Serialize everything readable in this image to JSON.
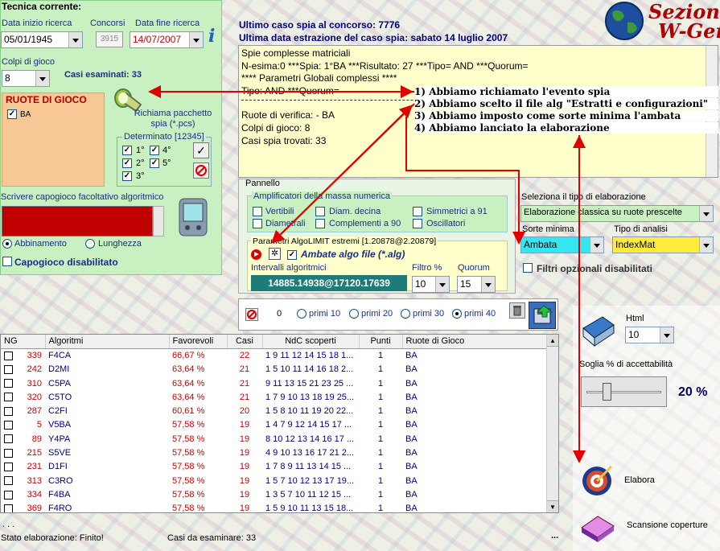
{
  "tecnica": {
    "title": "Tecnica corrente:",
    "data_inizio_label": "Data inizio ricerca",
    "data_inizio": "05/01/1945",
    "concorsi_label": "Concorsi",
    "concorsi": "3915",
    "data_fine_label": "Data fine ricerca",
    "data_fine": "14/07/2007",
    "colpi_label": "Colpi di gioco",
    "colpi": "8",
    "casi_esaminati": "Casi esaminati: 33"
  },
  "ruote": {
    "title": "RUOTE DI GIOCO",
    "item": "BA"
  },
  "richiama": {
    "label": "Richiama pacchetto spia (*.pcs)"
  },
  "determinato": {
    "title": "Determinato [12345]",
    "items": [
      "1°",
      "2°",
      "3°",
      "4°",
      "5°"
    ]
  },
  "capogioco": {
    "label": "Scrivere capogioco facoltativo algoritmico",
    "abbinamento": "Abbinamento",
    "lunghezza": "Lunghezza",
    "disabilitato": "Capogioco disabilitato"
  },
  "header": {
    "sezione": "Sezione",
    "wgen": "W-Gen",
    "ultimo": "Ultimo caso spia al concorso: 7776",
    "ultima_data": "Ultima data estrazione del caso spia: sabato 14 luglio 2007"
  },
  "report": {
    "lines": [
      "Spie complesse matriciali",
      "N-esima:0 ***Spia: 1°BA ***Risultato: 27 ***Tipo= AND ***Quorum=",
      "**** Parametri Globali complessi ****",
      "Tipo: AND ***Quorum=",
      "",
      "Ruote di verifica:  - BA",
      "Colpi di gioco: 8",
      "Casi spia trovati: 33"
    ]
  },
  "notes": [
    "1) Abbiamo richiamato l'evento spia",
    "2) Abbiamo scelto il file alg \"Estratti e configurazioni\"",
    "3) Abbiamo imposto come sorte minima l'ambata",
    "4) Abbiamo lanciato la elaborazione"
  ],
  "pannello": {
    "title": "Pannello",
    "ampl_title": "Amplificatori della massa numerica",
    "ampl": [
      "Vertibili",
      "Diametrali",
      "Diam. decina",
      "Complementi a 90",
      "Simmetrici a 91",
      "Oscillatori"
    ],
    "algolimit_title": "Parametri AlgoLIMIT estremi [1.20878@2.20879]",
    "ambate_algo": "Ambate algo file (*.alg)",
    "intervalli_label": "Intervalli algoritmici",
    "intervalli": "14885.14938@17120.17639",
    "filtro_label": "Filtro %",
    "filtro": "10",
    "quorum_label": "Quorum",
    "quorum": "15"
  },
  "elab": {
    "tipo_label": "Seleziona il tipo di elaborazione",
    "tipo": "Elaborazione classica su ruote prescelte",
    "sorte_label": "Sorte minima",
    "sorte": "Ambata",
    "analisi_label": "Tipo di analisi",
    "analisi": "IndexMat",
    "filtri": "Filtri opzionali disabilitati"
  },
  "primi": {
    "count": "0",
    "options": [
      "primi 10",
      "primi 20",
      "primi 30",
      "primi 40"
    ]
  },
  "right": {
    "html_label": "Html",
    "html": "10",
    "soglia_label": "Soglia % di accettabilità",
    "soglia": "20 %",
    "elabora": "Elabora",
    "scansione": "Scansione coperture"
  },
  "table": {
    "headers": [
      "NG",
      "Algoritmi",
      "Favorevoli",
      "Casi",
      "NdC scoperti",
      "Punti",
      "Ruote di Gioco"
    ],
    "rows": [
      [
        "339",
        "F4CA",
        "66,67 %",
        "22",
        "1 9 11 12 14 15 18 1...",
        "1",
        "BA"
      ],
      [
        "242",
        "D2MI",
        "63,64 %",
        "21",
        "1 5 10 11 14 16 18 2...",
        "1",
        "BA"
      ],
      [
        "310",
        "C5PA",
        "63,64 %",
        "21",
        "9 11 13 15 21 23 25 ...",
        "1",
        "BA"
      ],
      [
        "320",
        "C5TO",
        "63,64 %",
        "21",
        "1 7 9 10 13 18 19 25...",
        "1",
        "BA"
      ],
      [
        "287",
        "C2FI",
        "60,61 %",
        "20",
        "1 5 8 10 11 19 20 22...",
        "1",
        "BA"
      ],
      [
        "5",
        "V5BA",
        "57,58 %",
        "19",
        "1 4 7 9 12 14 15 17 ...",
        "1",
        "BA"
      ],
      [
        "89",
        "Y4PA",
        "57,58 %",
        "19",
        "8 10 12 13 14 16 17 ...",
        "1",
        "BA"
      ],
      [
        "215",
        "S5VE",
        "57,58 %",
        "19",
        "4 9 10 13 16 17 21 2...",
        "1",
        "BA"
      ],
      [
        "231",
        "D1FI",
        "57,58 %",
        "19",
        "1 7 8 9 11 13 14 15 ...",
        "1",
        "BA"
      ],
      [
        "313",
        "C3RO",
        "57,58 %",
        "19",
        "1 5 7 10 12 13 17 19...",
        "1",
        "BA"
      ],
      [
        "334",
        "F4BA",
        "57,58 %",
        "19",
        "1 3 5 7 10 11 12 15 ...",
        "1",
        "BA"
      ],
      [
        "369",
        "F4RO",
        "57,58 %",
        "19",
        "1 5 9 10 11 13 15 18...",
        "1",
        "BA"
      ]
    ]
  },
  "status": {
    "stato": "Stato elaborazione:  Finito!",
    "casi": "Casi da esaminare: 33",
    "dots": ". . .",
    "ellipsis": "..."
  },
  "colors": {
    "green_panel": "#c8f0c0",
    "orange_panel": "#f7c896",
    "yellow_panel": "#ffffcc",
    "red_arrow": "#e00000",
    "navy": "#000080",
    "teal": "#1e7c78"
  }
}
